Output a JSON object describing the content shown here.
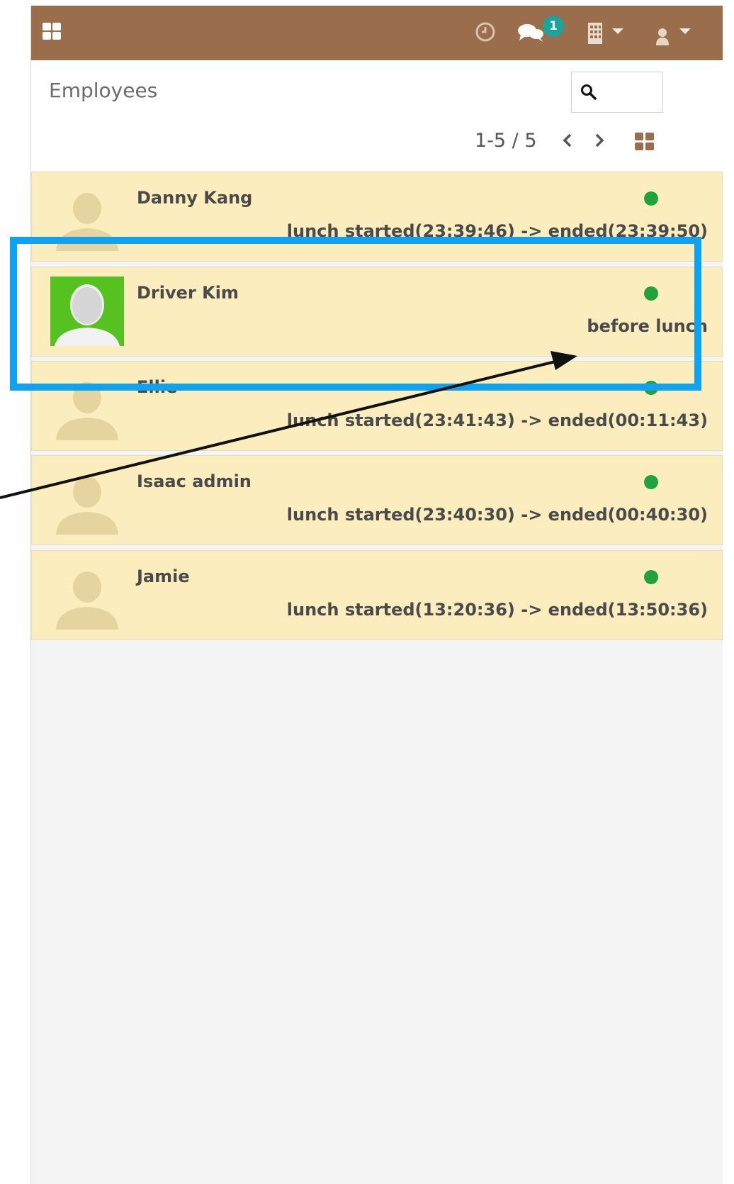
{
  "header": {
    "apps_icon": "apps-grid-icon",
    "clock_icon": "clock-icon",
    "chat_icon": "chat-icon",
    "chat_badge": "1",
    "building_icon": "building-icon",
    "user_icon": "user-avatar-icon",
    "bar_color": "#9a6e4c"
  },
  "control_panel": {
    "title": "Employees",
    "search_icon": "search-icon",
    "pager_value": "1-5 / 5",
    "view_icon": "kanban-view-icon"
  },
  "employees": [
    {
      "name": "Danny Kang",
      "lunch": "lunch started(23:39:46) -> ended(23:39:50)",
      "status_color": "#21a23f"
    },
    {
      "name": "Driver Kim",
      "lunch": "before lunch",
      "status_color": "#21a23f",
      "custom_avatar": true
    },
    {
      "name": "Ellie",
      "lunch": "lunch started(23:41:43) -> ended(00:11:43)",
      "status_color": "#21a23f"
    },
    {
      "name": "Isaac admin",
      "lunch": "lunch started(23:40:30) -> ended(00:40:30)",
      "status_color": "#21a23f"
    },
    {
      "name": "Jamie",
      "lunch": "lunch started(13:20:36) -> ended(13:50:36)",
      "status_color": "#21a23f"
    }
  ],
  "annotation": {
    "highlight_color": "#0ea2f0",
    "arrow_color": "#111111"
  }
}
